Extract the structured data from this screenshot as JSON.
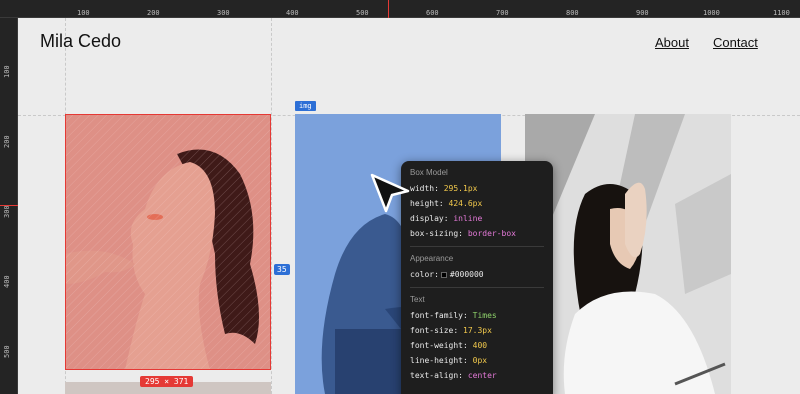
{
  "ruler": {
    "top_labels": [
      "100",
      "200",
      "300",
      "400",
      "500",
      "600",
      "700",
      "800",
      "900",
      "1000",
      "1100"
    ],
    "left_labels": [
      "100",
      "200",
      "300",
      "400",
      "500"
    ]
  },
  "site": {
    "title": "Mila Cedo",
    "nav": [
      "About",
      "Contact"
    ]
  },
  "overlay": {
    "element_tag": "img",
    "gap_value": "35",
    "selected_size": "295 × 371"
  },
  "inspector": {
    "box_model_title": "Box Model",
    "box_model": [
      {
        "key": "width:",
        "value": "295.1px",
        "color": "yellow"
      },
      {
        "key": "height:",
        "value": "424.6px",
        "color": "yellow"
      },
      {
        "key": "display:",
        "value": "inline",
        "color": "pink"
      },
      {
        "key": "box-sizing:",
        "value": "border-box",
        "color": "pink"
      }
    ],
    "appearance_title": "Appearance",
    "appearance": {
      "key": "color:",
      "value": "#000000",
      "swatch": "#000000"
    },
    "text_title": "Text",
    "text": [
      {
        "key": "font-family:",
        "value": "Times",
        "color": "green"
      },
      {
        "key": "font-size:",
        "value": "17.3px",
        "color": "yellow"
      },
      {
        "key": "font-weight:",
        "value": "400",
        "color": "yellow"
      },
      {
        "key": "line-height:",
        "value": "0px",
        "color": "yellow"
      },
      {
        "key": "text-align:",
        "value": "center",
        "color": "pink"
      }
    ]
  },
  "colors": {
    "selection_red": "#e53935",
    "highlight_blue": "#2d6fd6",
    "page_bg": "#ececec"
  },
  "icons": {
    "cursor": "arrow-cursor-icon"
  }
}
